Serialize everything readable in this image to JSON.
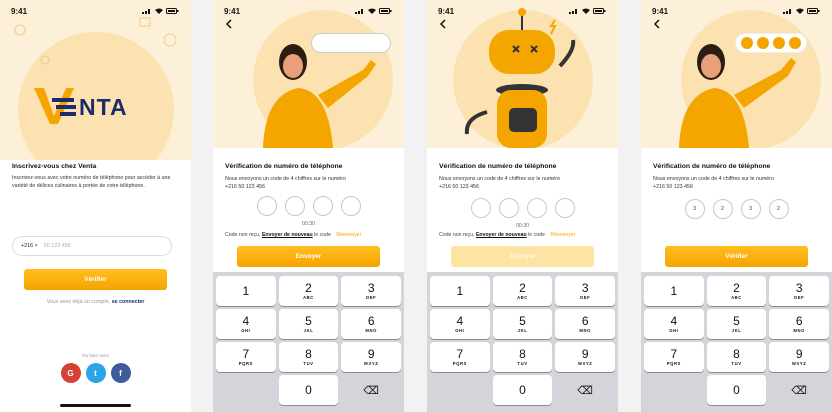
{
  "status_time": "9:41",
  "signup": {
    "logo": "VENTA",
    "title": "Inscrivez-vous chez Venta",
    "description": "Inscrivez-vous avec votre numéro de téléphone pour accéder à une variété de délices culinaires à portée de votre téléphone.",
    "country_code": "+216 ˅",
    "phone_placeholder": "50 123 456",
    "button": "Vérifier",
    "have_account": "Vous avez déjà un compte,",
    "login_link": "se connecter",
    "or_with": "Ou bien avec",
    "socials": [
      "G",
      "t",
      "f"
    ]
  },
  "verify": {
    "title": "Vérification de numéro de téléphone",
    "description": "Nous envoyons un code de 4 chiffres sur le numéro",
    "phone_number": "+216 50 123 456",
    "timer": "00:30",
    "not_received": "Code non reçu,",
    "resend_link": "Envoyer de nouveau",
    "resend_suffix": "le code",
    "resend_action": "Réenvoyer",
    "send_button": "Envoyer",
    "verify_button": "Vérifier",
    "entered_code": [
      "3",
      "2",
      "3",
      "2"
    ]
  },
  "keypad": [
    [
      {
        "num": "1",
        "letters": ""
      },
      {
        "num": "2",
        "letters": "ABC"
      },
      {
        "num": "3",
        "letters": "DEF"
      }
    ],
    [
      {
        "num": "4",
        "letters": "GHI"
      },
      {
        "num": "5",
        "letters": "JKL"
      },
      {
        "num": "6",
        "letters": "MNO"
      }
    ],
    [
      {
        "num": "7",
        "letters": "PQRS"
      },
      {
        "num": "8",
        "letters": "TUV"
      },
      {
        "num": "9",
        "letters": "WXYZ"
      }
    ],
    [
      {
        "num": "",
        "letters": ""
      },
      {
        "num": "0",
        "letters": ""
      },
      {
        "num": "⌫",
        "letters": ""
      }
    ]
  ],
  "colors": {
    "accent": "#f7a300",
    "brand_blue": "#1f2a6b",
    "hero_bg": "#fdf0d8"
  }
}
